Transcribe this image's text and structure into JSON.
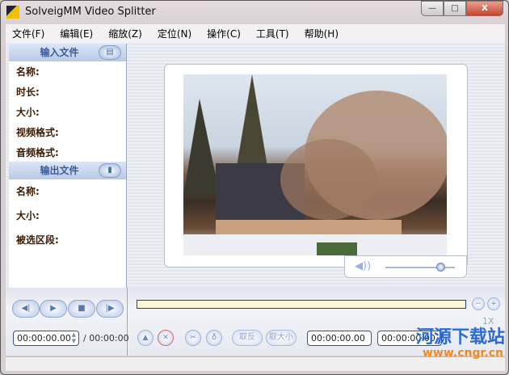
{
  "window": {
    "title": "SolveigMM Video Splitter",
    "min": "—",
    "max": "□",
    "close": "X"
  },
  "menu": [
    "文件(F)",
    "编辑(E)",
    "缩放(Z)",
    "定位(N)",
    "操作(C)",
    "工具(T)",
    "帮助(H)"
  ],
  "input_section": {
    "header": "输入文件",
    "fields": [
      "名称:",
      "时长:",
      "大小:",
      "视频格式:",
      "音频格式:"
    ]
  },
  "output_section": {
    "header": "输出文件",
    "fields": [
      "名称:",
      "大小:",
      "被选区段:"
    ]
  },
  "player": {
    "position": "00:00:00.00",
    "duration": "/ 00:00:00",
    "zoom": "1X",
    "volume": 0.8
  },
  "controls": {
    "start_time": "00:00:00.00",
    "end_time": "00:00:00.00",
    "btn_invert": "取反",
    "btn_size": "取大小"
  },
  "watermark": {
    "name": "河源下载站",
    "url": "www.cngr.cn"
  }
}
